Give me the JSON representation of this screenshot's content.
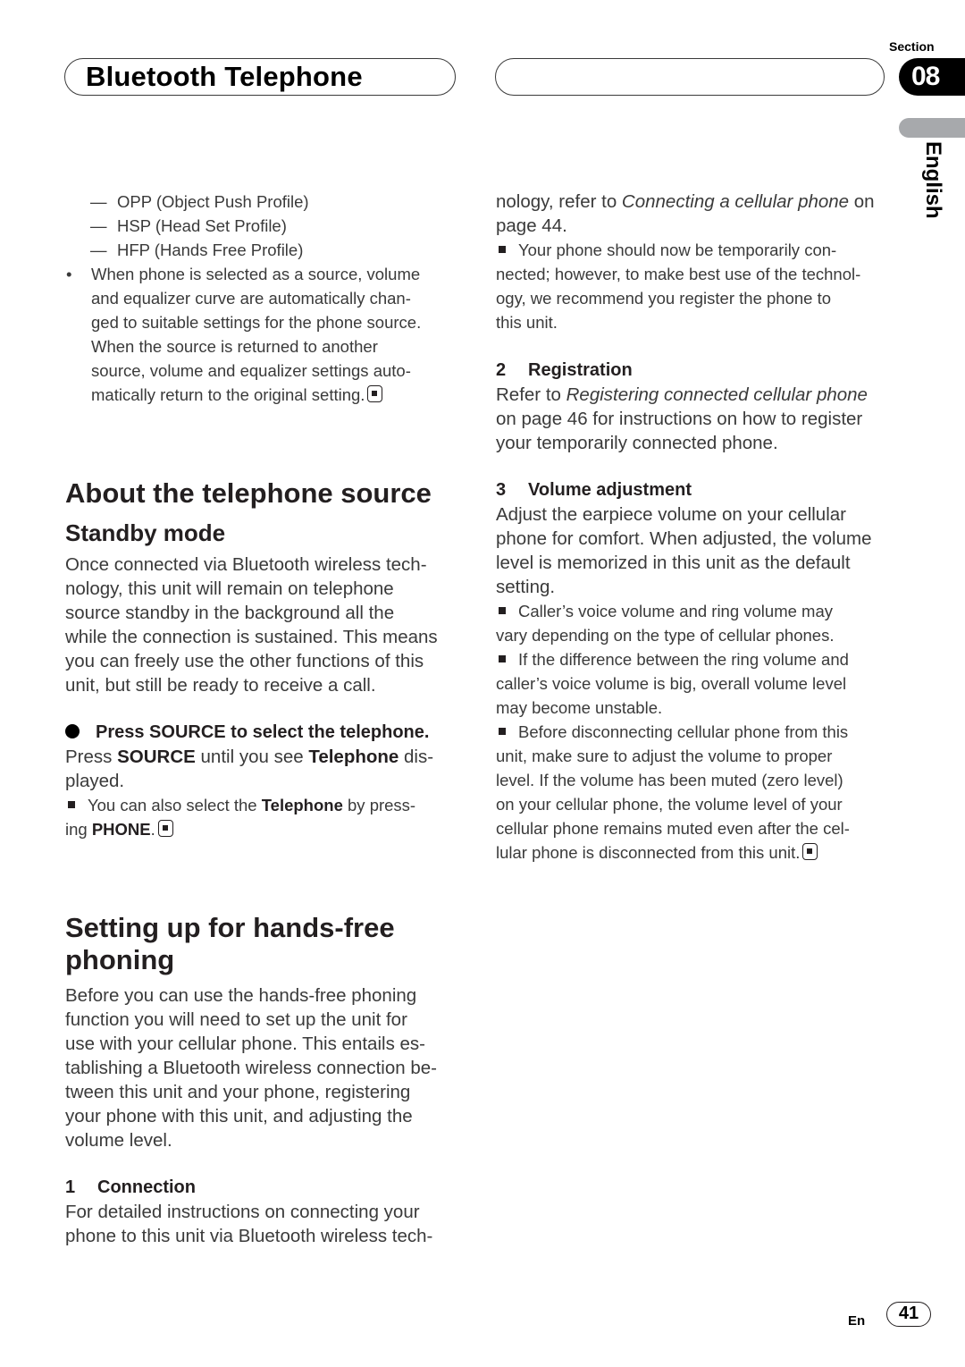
{
  "header": {
    "title": "Bluetooth Telephone",
    "section_label": "Section",
    "section_number": "08",
    "language_tab": "English"
  },
  "left_column": {
    "profile_list": [
      {
        "dash": "—",
        "text": "OPP (Object Push Profile)"
      },
      {
        "dash": "—",
        "text": "HSP (Head Set Profile)"
      },
      {
        "dash": "—",
        "text": "HFP (Hands Free Profile)"
      }
    ],
    "bullet_note": {
      "bullet": "•",
      "lines": [
        "When phone is selected as a source, volume",
        "and equalizer curve are automatically chan-",
        "ged to suitable settings for the phone source.",
        "When the source is returned to another",
        "source, volume and equalizer settings auto-",
        "matically return to the original setting."
      ]
    },
    "about_heading": "About the telephone source",
    "standby_heading": "Standby mode",
    "standby_text": [
      "Once connected via Bluetooth wireless tech-",
      "nology, this unit will remain on telephone",
      "source standby in the background all the",
      "while the connection is sustained. This means",
      "you can freely use the other functions of this",
      "unit, but still be ready to receive a call."
    ],
    "step_heading": "Press SOURCE to select the telephone.",
    "step_text": {
      "a": "Press ",
      "b": "SOURCE",
      "c": " until you see ",
      "d": "Telephone",
      "e": " dis-",
      "f": "played."
    },
    "step_note": {
      "a": "You can also select the ",
      "b": "Telephone",
      "c": " by press-",
      "d": "ing ",
      "e": "PHONE",
      "f": "."
    },
    "setup_heading_line1": "Setting up for hands-free",
    "setup_heading_line2": "phoning",
    "setup_text": [
      "Before you can use the hands-free phoning",
      "function you will need to set up the unit for",
      "use with your cellular phone. This entails es-",
      "tablishing a Bluetooth wireless connection be-",
      "tween this unit and your phone, registering",
      "your phone with this unit, and adjusting the",
      "volume level."
    ],
    "connection": {
      "number": "1",
      "heading": "Connection",
      "lines": [
        "For detailed instructions on connecting your",
        "phone to this unit via Bluetooth wireless tech-"
      ]
    }
  },
  "right_column": {
    "continuation": {
      "a": "nology, refer to ",
      "b": "Connecting a cellular phone",
      "c": " on",
      "d": "page 44."
    },
    "temp_note": [
      "Your phone should now be temporarily con-",
      "nected; however, to make best use of the technol-",
      "ogy, we recommend you register the phone to",
      "this unit."
    ],
    "registration": {
      "number": "2",
      "heading": "Registration",
      "a": "Refer to ",
      "b": "Registering connected cellular phone",
      "c": "on page 46 for instructions on how to register",
      "d": "your temporarily connected phone."
    },
    "volume": {
      "number": "3",
      "heading": "Volume adjustment",
      "lines": [
        "Adjust the earpiece volume on your cellular",
        "phone for comfort. When adjusted, the volume",
        "level is memorized in this unit as the default",
        "setting."
      ],
      "notes": [
        [
          "Caller’s voice volume and ring volume may",
          "vary depending on the type of cellular phones."
        ],
        [
          "If the difference between the ring volume and",
          "caller’s voice volume is big, overall volume level",
          "may become unstable."
        ],
        [
          "Before disconnecting cellular phone from this",
          "unit, make sure to adjust the volume to proper",
          "level. If the volume has been muted (zero level)",
          "on your cellular phone, the volume level of your",
          "cellular phone remains muted even after the cel-",
          "lular phone is disconnected from this unit."
        ]
      ]
    }
  },
  "footer": {
    "language_code": "En",
    "page_number": "41"
  }
}
